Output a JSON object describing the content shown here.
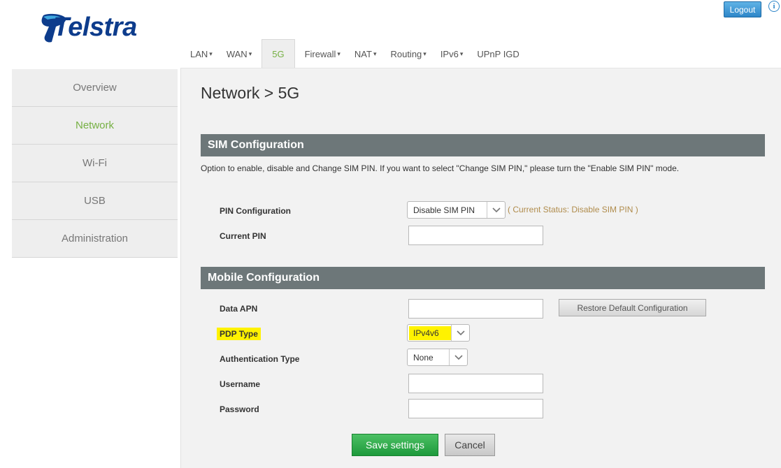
{
  "header": {
    "brand": "Telstra",
    "logout_label": "Logout",
    "info_symbol": "i"
  },
  "tabs": [
    {
      "label": "LAN",
      "caret": "▾"
    },
    {
      "label": "WAN",
      "caret": "▾"
    },
    {
      "label": "5G",
      "caret": ""
    },
    {
      "label": "Firewall",
      "caret": "▾"
    },
    {
      "label": "NAT",
      "caret": "▾"
    },
    {
      "label": "Routing",
      "caret": "▾"
    },
    {
      "label": "IPv6",
      "caret": "▾"
    },
    {
      "label": "UPnP IGD",
      "caret": ""
    }
  ],
  "sidebar": {
    "items": [
      {
        "label": "Overview"
      },
      {
        "label": "Network"
      },
      {
        "label": "Wi-Fi"
      },
      {
        "label": "USB"
      },
      {
        "label": "Administration"
      }
    ]
  },
  "main": {
    "title": "Network > 5G",
    "sim": {
      "heading": "SIM Configuration",
      "description": "Option to enable, disable and Change SIM PIN. If you want to select \"Change SIM PIN,\" please turn the \"Enable SIM PIN\" mode.",
      "pin_config_label": "PIN Configuration",
      "pin_config_value": "Disable SIM PIN",
      "pin_status": "( Current Status: Disable SIM PIN )",
      "current_pin_label": "Current PIN",
      "current_pin_value": ""
    },
    "mobile": {
      "heading": "Mobile Configuration",
      "apn_label": "Data APN",
      "apn_value": "",
      "restore_label": "Restore Default Configuration",
      "pdp_label": "PDP Type",
      "pdp_value": "IPv4v6",
      "auth_label": "Authentication Type",
      "auth_value": "None",
      "username_label": "Username",
      "username_value": "",
      "password_label": "Password",
      "password_value": ""
    },
    "save_label": "Save settings",
    "cancel_label": "Cancel"
  },
  "colors": {
    "accent_green": "#76b043",
    "section_bar": "#6d7779",
    "highlight": "#fff200",
    "status_text": "#b08c4c",
    "logout_blue": "#2e86c8"
  }
}
